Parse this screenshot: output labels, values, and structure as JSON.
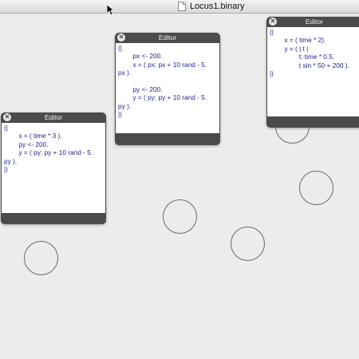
{
  "window": {
    "title": "Locus1.binary"
  },
  "editors": [
    {
      "title": "Editor",
      "close_symbol": "✕",
      "lines": [
        "(|",
        "        x = ( time * 3 ).",
        "        py <- 200.",
        "        y = ( py: py + 10 rand - 5.",
        "py ).",
        "|)"
      ]
    },
    {
      "title": "Editor",
      "close_symbol": "✕",
      "lines": [
        "(|",
        "        px <- 200.",
        "        x = ( px: px + 10 rand - 5.",
        "px ).",
        "",
        "        py <- 200.",
        "        y = ( py: py + 10 rand - 5.",
        "py ).",
        "|)"
      ]
    },
    {
      "title": "Editor",
      "close_symbol": "✕",
      "lines": [
        "(|",
        "        x = ( time * 2).",
        "        y = ( | t |",
        "                t: time * 0.5.",
        "                t sin * 50 + 200 ).",
        "|)"
      ]
    }
  ],
  "colors": {
    "background": "#ececec",
    "editor_frame": "#4b4b4b",
    "code_text": "#1e1e8c",
    "circle_stroke": "#6a6a6a"
  }
}
